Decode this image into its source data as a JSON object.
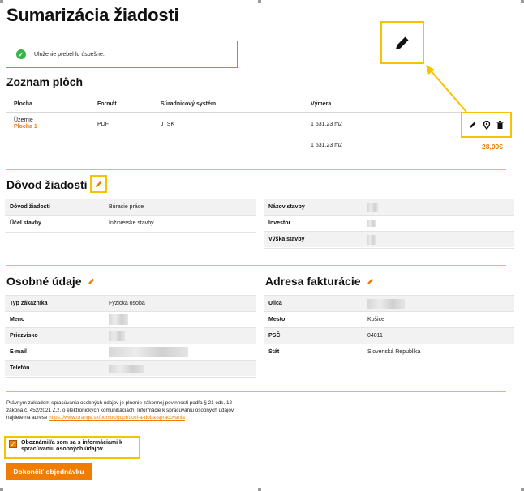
{
  "page_title": "Sumarizácia žiadosti",
  "success_message": "Uloženie prebehlo úspešne.",
  "areas": {
    "title": "Zoznam plôch",
    "columns": [
      "Plocha",
      "Formát",
      "Súradnicový systém",
      "Výmera"
    ],
    "row": {
      "label": "Územie",
      "name": "Plocha 1",
      "format": "PDF",
      "system": "JTSK",
      "area": "1 531,23 m2"
    },
    "total_area": "1 531,23 m2",
    "price": "28,00€"
  },
  "reason": {
    "title": "Dôvod žiadosti",
    "left": [
      {
        "key": "Dôvod žiadosti",
        "value": "Búracie práce"
      },
      {
        "key": "Účel stavby",
        "value": "Inžinierske stavby"
      }
    ],
    "right": [
      {
        "key": "Názov stavby",
        "value": ""
      },
      {
        "key": "Investor",
        "value": ""
      },
      {
        "key": "Výška stavby",
        "value": ""
      }
    ]
  },
  "personal": {
    "title": "Osobné údaje",
    "rows": [
      {
        "key": "Typ zákazníka",
        "value": "Fyzická osoba"
      },
      {
        "key": "Meno",
        "value": ""
      },
      {
        "key": "Priezvisko",
        "value": ""
      },
      {
        "key": "E-mail",
        "value": ""
      },
      {
        "key": "Telefón",
        "value": ""
      }
    ]
  },
  "billing": {
    "title": "Adresa fakturácie",
    "rows": [
      {
        "key": "Ulica",
        "value": ""
      },
      {
        "key": "Mesto",
        "value": "Košice"
      },
      {
        "key": "PSČ",
        "value": "04011"
      },
      {
        "key": "Štát",
        "value": "Slovenská Republika"
      }
    ]
  },
  "legal": {
    "text": "Právnym základom spracúvania osobných údajov je plnenie zákonnej povinnosti podľa § 21 ods. 12 zákona č. 452/2021 Z.z. o elektronických komunikáciách. Informácie k spracúvaniu osobných údajov nájdete na adrese",
    "link": "https://www.orange.sk/pomoc/gdpr/ucel-a-doba-spracovania"
  },
  "consent_label": "Oboznámil/a som sa s informáciami k spracúvaniu osobných údajov",
  "submit_label": "Dokončiť objednávku",
  "colors": {
    "accent": "#f07d00",
    "highlight": "#f9c200",
    "success": "#35b54a"
  },
  "icons": [
    "check-icon",
    "pencil-icon",
    "map-pin-icon",
    "trash-icon",
    "checkbox-checked-icon"
  ]
}
